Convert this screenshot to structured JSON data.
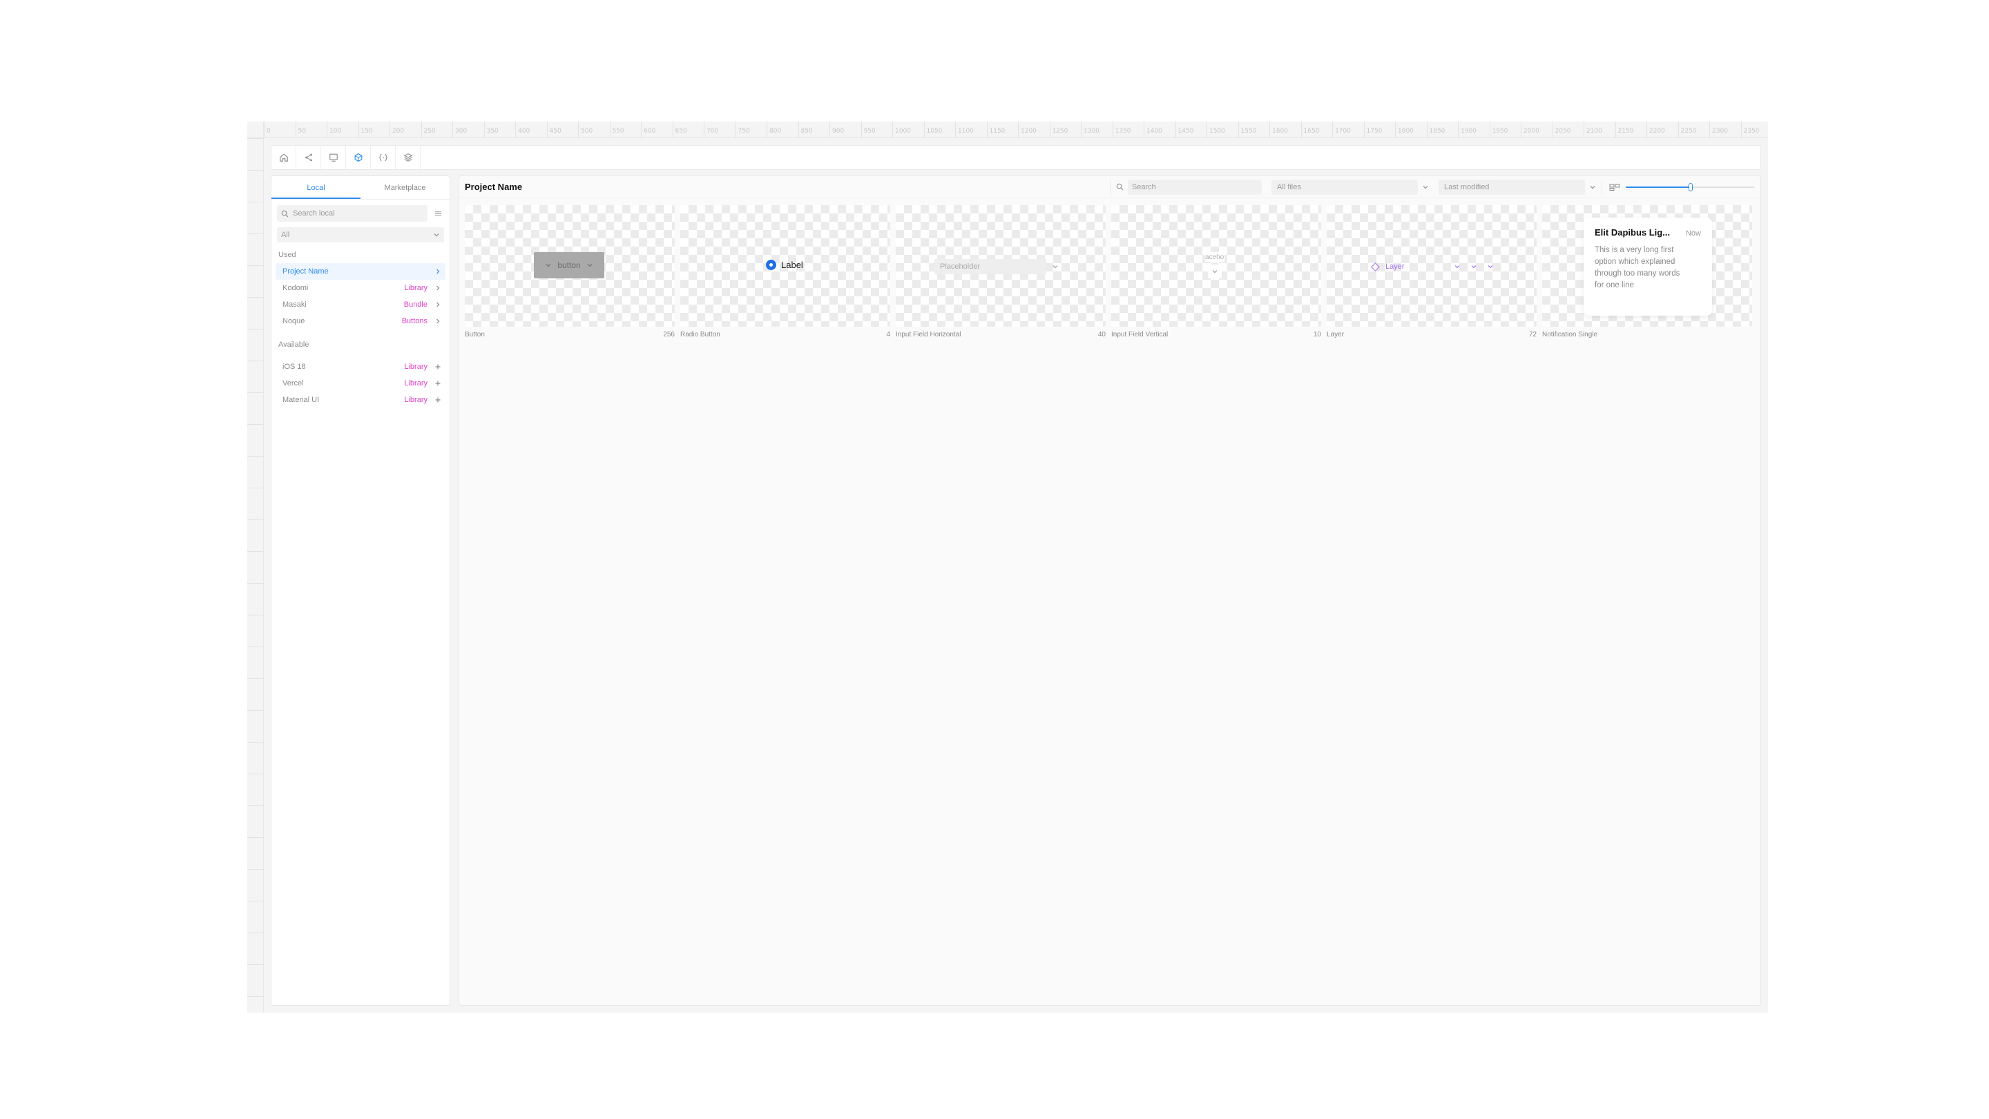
{
  "ruler": {
    "top_labels": [
      "0",
      "50",
      "100",
      "150",
      "200",
      "250",
      "300",
      "350",
      "400",
      "450",
      "500",
      "550",
      "600",
      "650",
      "700",
      "750",
      "800",
      "850",
      "900",
      "950",
      "1000",
      "1050",
      "1100",
      "1150",
      "1200",
      "1250",
      "1300",
      "1350",
      "1400",
      "1450",
      "1500",
      "1550",
      "1600",
      "1650",
      "1700",
      "1750",
      "1800",
      "1850",
      "1900",
      "1950",
      "2000",
      "2050",
      "2100",
      "2150",
      "2200",
      "2250",
      "2300",
      "2350"
    ]
  },
  "toolbar": {
    "buttons": [
      {
        "icon": "home-icon"
      },
      {
        "icon": "share-icon"
      },
      {
        "icon": "monitor-icon"
      },
      {
        "icon": "component-icon",
        "active": true
      },
      {
        "icon": "variables-icon"
      },
      {
        "icon": "layers-icon"
      }
    ]
  },
  "sidebar": {
    "tabs": [
      {
        "label": "Local",
        "active": true
      },
      {
        "label": "Marketplace",
        "active": false
      }
    ],
    "search_placeholder": "Search local",
    "filter_value": "All",
    "used_label": "Used",
    "used_items": [
      {
        "name": "Project Name",
        "badge": "",
        "selected": true
      },
      {
        "name": "Kodomi",
        "badge": "Library",
        "selected": false
      },
      {
        "name": "Masaki",
        "badge": "Bundle",
        "selected": false
      },
      {
        "name": "Noque",
        "badge": "Buttons",
        "selected": false
      }
    ],
    "available_label": "Available",
    "available_items": [
      {
        "name": "iOS 18",
        "badge": "Library"
      },
      {
        "name": "Vercel",
        "badge": "Library"
      },
      {
        "name": "Material UI",
        "badge": "Library"
      }
    ]
  },
  "main": {
    "title": "Project Name",
    "search_placeholder": "Search",
    "files_filter": "All files",
    "sort": "Last modified",
    "zoom_level": 0.5,
    "cards": [
      {
        "name": "Button",
        "count": "256",
        "preview": {
          "label": "button"
        }
      },
      {
        "name": "Radio Button",
        "count": "4",
        "preview": {
          "label": "Label"
        }
      },
      {
        "name": "Input Field Horizontal",
        "count": "40",
        "preview": {
          "placeholder": "Placeholder"
        }
      },
      {
        "name": "Input Field Vertical",
        "count": "10",
        "preview": {
          "text": "aceho"
        }
      },
      {
        "name": "Layer",
        "count": "72",
        "preview": {
          "label": "Layer"
        }
      },
      {
        "name": "Notification Single",
        "count": "",
        "preview": {
          "title": "Elit Dapibus Lig...",
          "time": "Now",
          "body": "This is a very long first option which explained through too many words for one line"
        }
      }
    ]
  },
  "colors": {
    "accent": "#2d8cf0",
    "badge": "#e040c9",
    "layer": "#a06ef0",
    "radio": "#1f6fe8"
  }
}
